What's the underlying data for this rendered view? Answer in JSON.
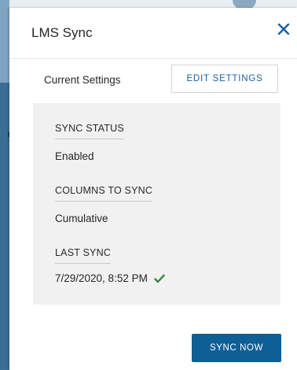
{
  "dialog": {
    "title": "LMS Sync",
    "close_icon": "close-icon"
  },
  "settings": {
    "label": "Current Settings",
    "edit_button": "EDIT SETTINGS"
  },
  "status": {
    "sync_status_label": "SYNC STATUS",
    "sync_status_value": "Enabled",
    "columns_label": "COLUMNS TO SYNC",
    "columns_value": "Cumulative",
    "last_sync_label": "LAST SYNC",
    "last_sync_value": "7/29/2020, 8:52 PM",
    "last_sync_icon": "checkmark-icon"
  },
  "footer": {
    "sync_button": "SYNC NOW"
  },
  "colors": {
    "primary": "#0f5f97",
    "link": "#1b5fa0",
    "success": "#2e8b3a",
    "panel_bg": "#f1f1f1"
  }
}
